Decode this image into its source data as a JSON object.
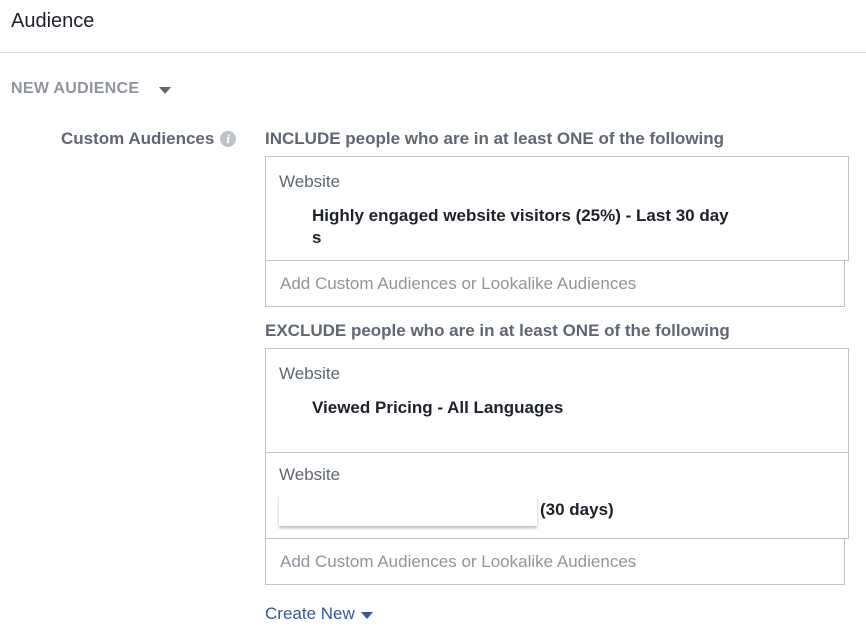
{
  "header": {
    "title": "Audience"
  },
  "new_audience": {
    "label": "NEW AUDIENCE"
  },
  "custom_audiences": {
    "label": "Custom Audiences",
    "include": {
      "heading": "INCLUDE people who are in at least ONE of the following",
      "items": [
        {
          "source": "Website",
          "name_line1": "Highly engaged website visitors (25%) - Last 30 day",
          "name_line2": "s"
        }
      ],
      "add_placeholder": "Add Custom Audiences or Lookalike Audiences"
    },
    "exclude": {
      "heading": "EXCLUDE people who are in at least ONE of the following",
      "items": [
        {
          "source": "Website",
          "name": "Viewed Pricing - All Languages"
        },
        {
          "source": "Website",
          "name_suffix": "(30 days)"
        }
      ],
      "add_placeholder": "Add Custom Audiences or Lookalike Audiences"
    }
  },
  "create_new": {
    "label": "Create New"
  },
  "colors": {
    "link": "#365899",
    "muted": "#90949c",
    "border": "#bec2c9"
  }
}
